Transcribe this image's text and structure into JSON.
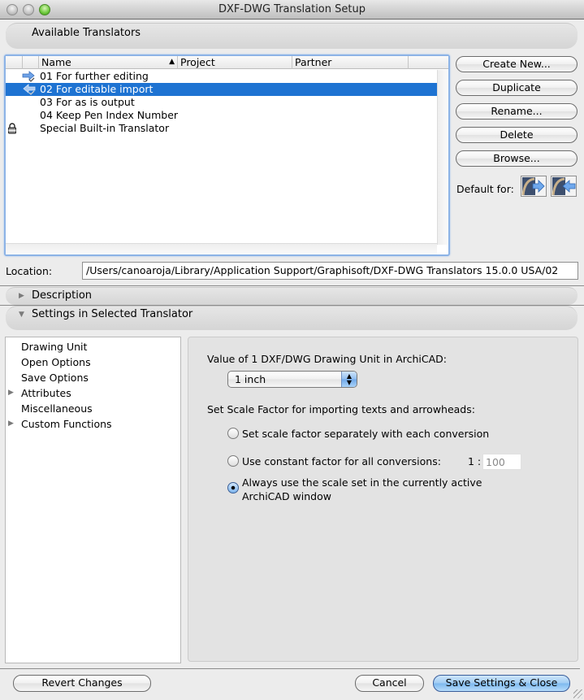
{
  "window": {
    "title": "DXF-DWG Translation Setup"
  },
  "available_translators": {
    "section_label": "Available Translators",
    "columns": [
      {
        "label": "",
        "key": "default"
      },
      {
        "label": "",
        "key": "icon"
      },
      {
        "label": "Name",
        "key": "name",
        "sort": "ascending"
      },
      {
        "label": "Project",
        "key": "project"
      },
      {
        "label": "Partner",
        "key": "partner"
      }
    ],
    "sort_indicator": "▲",
    "rows": [
      {
        "name": "01 For further editing",
        "icon": "export-arrow-icon",
        "selected": false,
        "locked": false
      },
      {
        "name": "02 For editable import",
        "icon": "import-arrow-icon",
        "selected": true,
        "locked": false
      },
      {
        "name": "03 For as is output",
        "icon": "",
        "selected": false,
        "locked": false
      },
      {
        "name": "04 Keep Pen Index Number",
        "icon": "",
        "selected": false,
        "locked": false
      },
      {
        "name": "Special Built-in Translator",
        "icon": "",
        "selected": false,
        "locked": true
      }
    ]
  },
  "actions": {
    "create_new": "Create New...",
    "duplicate": "Duplicate",
    "rename": "Rename...",
    "delete": "Delete",
    "browse": "Browse...",
    "default_for_label": "Default for:"
  },
  "location": {
    "label": "Location:",
    "value": "/Users/canoaroja/Library/Application Support/Graphisoft/DXF-DWG Translators 15.0.0 USA/02"
  },
  "description_section": {
    "label": "Description",
    "expanded": false
  },
  "settings_section": {
    "label": "Settings in Selected Translator",
    "expanded": true
  },
  "settings_tree": [
    {
      "label": "Drawing Unit",
      "expandable": false
    },
    {
      "label": "Open Options",
      "expandable": false
    },
    {
      "label": "Save Options",
      "expandable": false
    },
    {
      "label": "Attributes",
      "expandable": true
    },
    {
      "label": "Miscellaneous",
      "expandable": false
    },
    {
      "label": "Custom Functions",
      "expandable": true
    }
  ],
  "drawing_unit": {
    "value_label": "Value of 1 DXF/DWG Drawing Unit in ArchiCAD:",
    "unit_selected": "1 inch",
    "scale_label": "Set Scale Factor for importing texts and arrowheads:",
    "options": [
      {
        "label": "Set scale factor separately with each conversion",
        "checked": false
      },
      {
        "label": "Use constant factor for all conversions:",
        "checked": false
      },
      {
        "label_line1": "Always use the scale set in the currently active",
        "label_line2": "ArchiCAD window",
        "checked": true
      }
    ],
    "ratio_prefix": "1 :",
    "ratio_value": "100"
  },
  "footer": {
    "revert": "Revert Changes",
    "cancel": "Cancel",
    "save_close": "Save Settings & Close"
  },
  "colors": {
    "selection": "#1e73d2",
    "focus_ring": "#8cb3e6",
    "primary_button": "#7db8ee"
  }
}
